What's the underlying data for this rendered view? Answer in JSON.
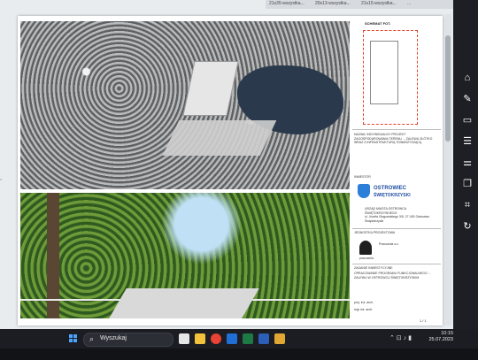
{
  "browser": {
    "tabs": [
      "21s35-wszystka...",
      "20s13-wszystka...",
      "21s15-wszystka...",
      "..."
    ]
  },
  "document": {
    "left_margin_label": "=",
    "sidebar": {
      "scheme_title": "SCHEMAT FOT.",
      "project_desc": "NAZWA: INDYWIDUALNY PROJEKT ZAGOSPODAROWANIA TERENU ... ZALEWU ZŁÓTKO WRAZ Z INFRASTRUKTURĄ TOWARZYSZĄCĄ",
      "investor_label": "INWESTOR",
      "city_name": "OSTROWIEC",
      "city_sub": "ŚWIĘTOKRZYSKI",
      "office": "URZĄD MIASTA OSTROWCA ŚWIĘTOKRZYSKIEGO",
      "address": "ul. Józefa Głogowskiego 3/5, 27-400 Ostrowiec Świętokrzyski",
      "designer_label": "JEDNOSTKA PROJEKTOWA",
      "designer_name": "pracownia",
      "designer_address": "Pracownia s.c.",
      "stage_label": "ZADANIE INWESTYCYJNE",
      "stage_desc": "OPRACOWANIE PROGRAMU FUNKCJONALNEGO ... ZALEWU W OSTROWCU ŚWIĘTOKRZYSKIM",
      "author1": "proj. inż. arch.",
      "author2": "mgr inż. arch.",
      "page": "1 / 1"
    }
  },
  "right_toolbar": {
    "icons": [
      "home-icon",
      "pen-icon",
      "monitor-icon",
      "list-icon",
      "sliders-icon",
      "copy-icon",
      "crop-icon",
      "refresh-icon"
    ]
  },
  "taskbar": {
    "search_placeholder": "Wyszukaj",
    "apps": [
      {
        "name": "files-app",
        "color": "#e6e6e6"
      },
      {
        "name": "explorer-app",
        "color": "#f3c23c"
      },
      {
        "name": "chrome-app",
        "color": "#ea4335"
      },
      {
        "name": "outlook-app",
        "color": "#1f6fd6"
      },
      {
        "name": "excel-app",
        "color": "#1d7a44"
      },
      {
        "name": "word-app",
        "color": "#2b5fb8"
      },
      {
        "name": "pdf-app",
        "color": "#e0a732"
      }
    ],
    "time": "10:15",
    "date": "25.07.2023"
  }
}
